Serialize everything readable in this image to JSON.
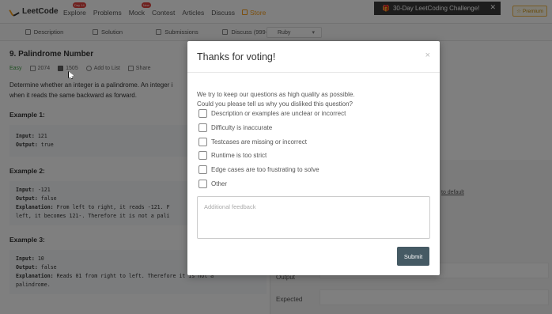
{
  "navbar": {
    "logo_text": "LeetCode",
    "links": [
      {
        "label": "Explore",
        "badge": "Day 14"
      },
      {
        "label": "Problems",
        "badge": ""
      },
      {
        "label": "Mock",
        "badge": "New"
      },
      {
        "label": "Contest",
        "badge": ""
      },
      {
        "label": "Articles",
        "badge": ""
      },
      {
        "label": "Discuss",
        "badge": ""
      }
    ],
    "store_label": "Store",
    "challenge_text": "30-Day LeetCoding Challenge!",
    "challenge_close": "✕",
    "premium_label": "Premium"
  },
  "tabs": {
    "description": "Description",
    "solution": "Solution",
    "submissions": "Submissions",
    "discuss": "Discuss (999+)",
    "language": "Ruby"
  },
  "problem": {
    "title": "9. Palindrome Number",
    "difficulty": "Easy",
    "likes": "2074",
    "dislikes": "1505",
    "add_to_list": "Add to List",
    "share": "Share",
    "description_line1": "Determine whether an integer is a palindrome. An integer i",
    "description_line2": "when it reads the same backward as forward.",
    "examples": [
      {
        "title": "Example 1:",
        "input_label": "Input:",
        "input": "121",
        "output_label": "Output:",
        "output": "true",
        "explanation_label": "",
        "explanation1": "",
        "explanation2": ""
      },
      {
        "title": "Example 2:",
        "input_label": "Input:",
        "input": "-121",
        "output_label": "Output:",
        "output": "false",
        "explanation_label": "Explanation:",
        "explanation1": "From left to right, it reads -121. F",
        "explanation2": "left, it becomes 121-. Therefore it is not a pali"
      },
      {
        "title": "Example 3:",
        "input_label": "Input:",
        "input": "10",
        "output_label": "Output:",
        "output": "false",
        "explanation_label": "Explanation:",
        "explanation1": "Reads 01 from right to left. Therefore it is not a",
        "explanation2": "palindrome."
      }
    ]
  },
  "right_panel": {
    "reset_link": "to default",
    "output_label": "Output",
    "expected_label": "Expected"
  },
  "modal": {
    "title": "Thanks for voting!",
    "close_symbol": "×",
    "intro_line1": "We try to keep our questions as high quality as possible.",
    "intro_line2": "Could you please tell us why you disliked this question?",
    "options": [
      "Description or examples are unclear or incorrect",
      "Difficulty is inaccurate",
      "Testcases are missing or incorrect",
      "Runtime is too strict",
      "Edge cases are too frustrating to solve",
      "Other"
    ],
    "feedback_placeholder": "Additional feedback",
    "submit_label": "Submit"
  }
}
